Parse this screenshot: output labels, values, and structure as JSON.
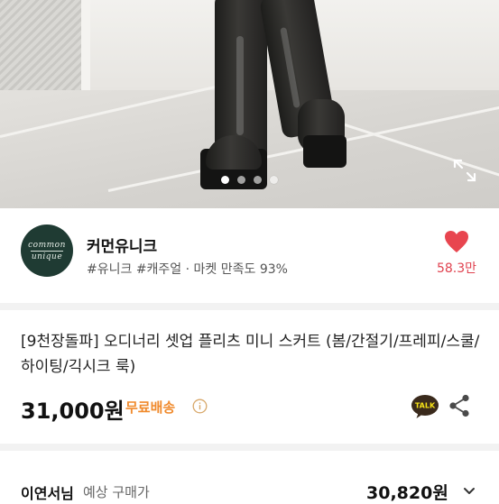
{
  "hero": {
    "image_subject": "black knee-high platform boots on tiled floor",
    "slides": [
      true,
      false,
      false,
      false
    ],
    "expand_icon": "expand-icon"
  },
  "seller": {
    "logo_text_top": "common",
    "logo_text_bottom": "unique",
    "name": "커먼유니크",
    "tags": "#유니크 #캐주얼 · 마켓 만족도 93%",
    "like_icon": "heart-icon",
    "like_count": "58.3만",
    "like_color": "#e8454f"
  },
  "product": {
    "title": "[9천장돌파] 오디너리 셋업 플리츠 미니 스커트 (봄/간절기/프레피/스쿨/하이팅/긱시크 룩)",
    "price": "31,000원",
    "shipping": "무료배송",
    "shipping_color": "#f08a2c",
    "talk_label": "TALK",
    "share_icon": "share-icon"
  },
  "estimate": {
    "buyer": "이연서님",
    "label": "예상 구매가",
    "price": "30,820원"
  }
}
